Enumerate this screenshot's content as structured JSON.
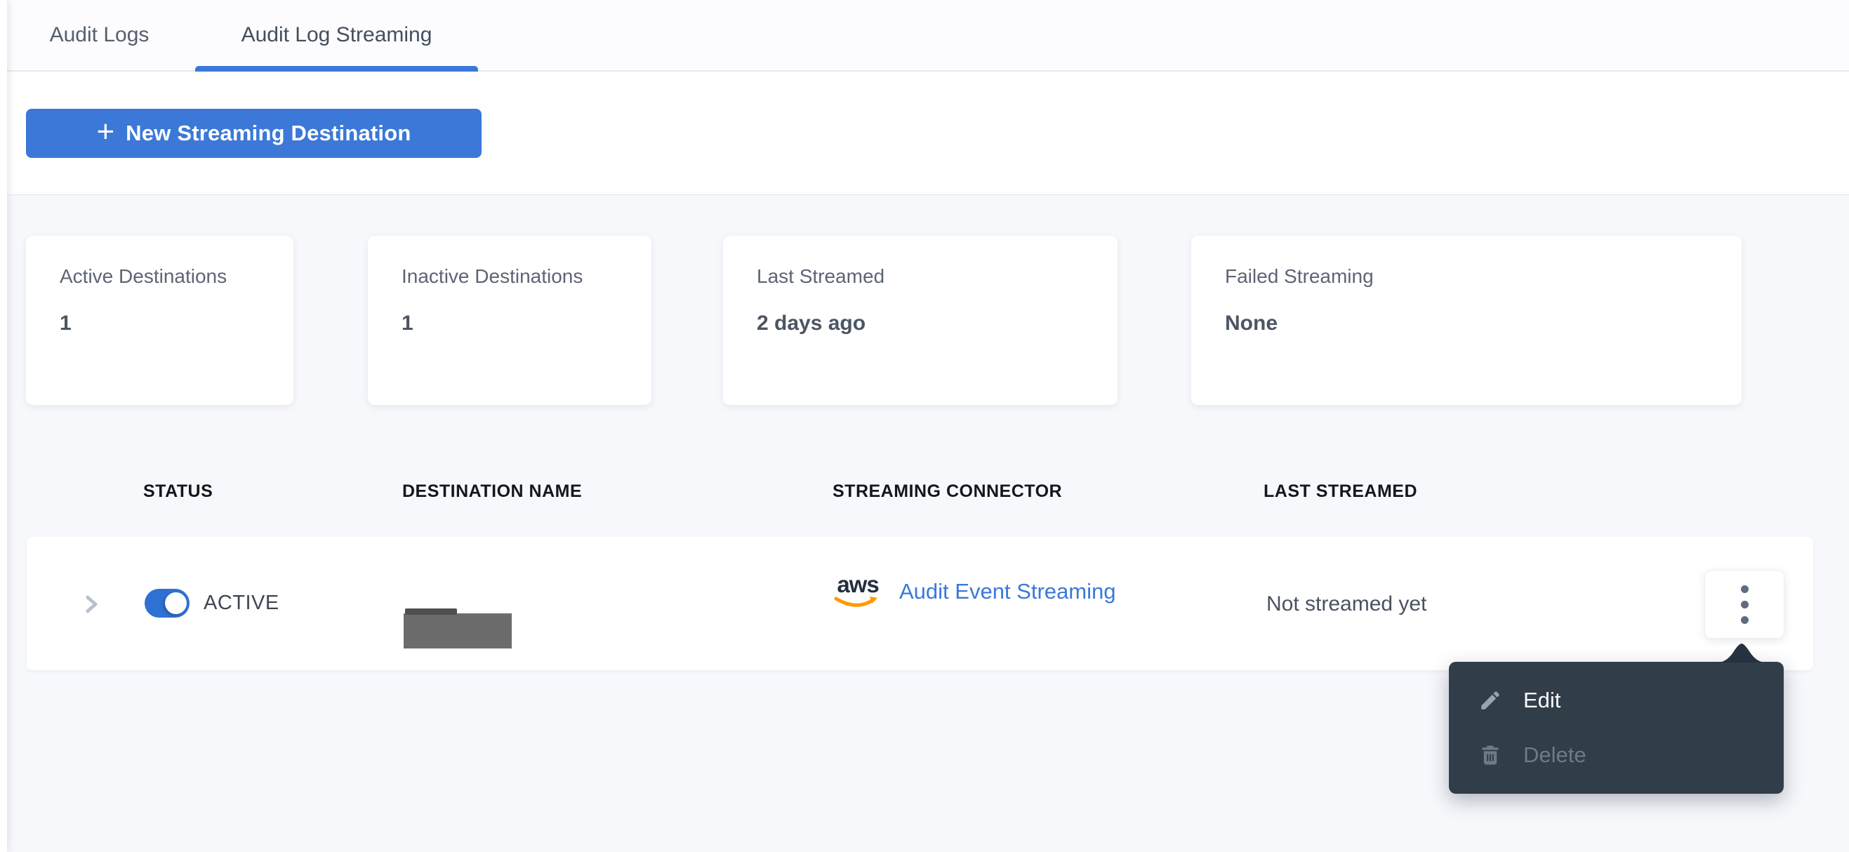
{
  "tabs": {
    "items": [
      {
        "label": "Audit Logs",
        "active": false
      },
      {
        "label": "Audit Log Streaming",
        "active": true
      }
    ]
  },
  "toolbar": {
    "plus": "+",
    "new_button_label": "New Streaming Destination"
  },
  "stats": {
    "cards": [
      {
        "label": "Active Destinations",
        "value": "1"
      },
      {
        "label": "Inactive Destinations",
        "value": "1"
      },
      {
        "label": "Last Streamed",
        "value": "2 days ago"
      },
      {
        "label": "Failed Streaming",
        "value": "None"
      }
    ]
  },
  "table": {
    "headers": [
      "STATUS",
      "DESTINATION NAME",
      "STREAMING CONNECTOR",
      "LAST STREAMED"
    ],
    "row": {
      "status_label": "ACTIVE",
      "status_on": true,
      "destination_name_redacted": true,
      "connector_brand": "aws",
      "connector_label": "Audit Event Streaming",
      "last_streamed": "Not streamed yet"
    }
  },
  "menu": {
    "items": [
      {
        "label": "Edit",
        "enabled": true
      },
      {
        "label": "Delete",
        "enabled": false
      }
    ]
  },
  "colors": {
    "accent": "#3b78d8",
    "toggle": "#2e71d2",
    "menu_bg": "#313d49",
    "menu_arrow": "#263240",
    "aws_smile": "#ff9900",
    "aws_text": "#252f3e"
  }
}
